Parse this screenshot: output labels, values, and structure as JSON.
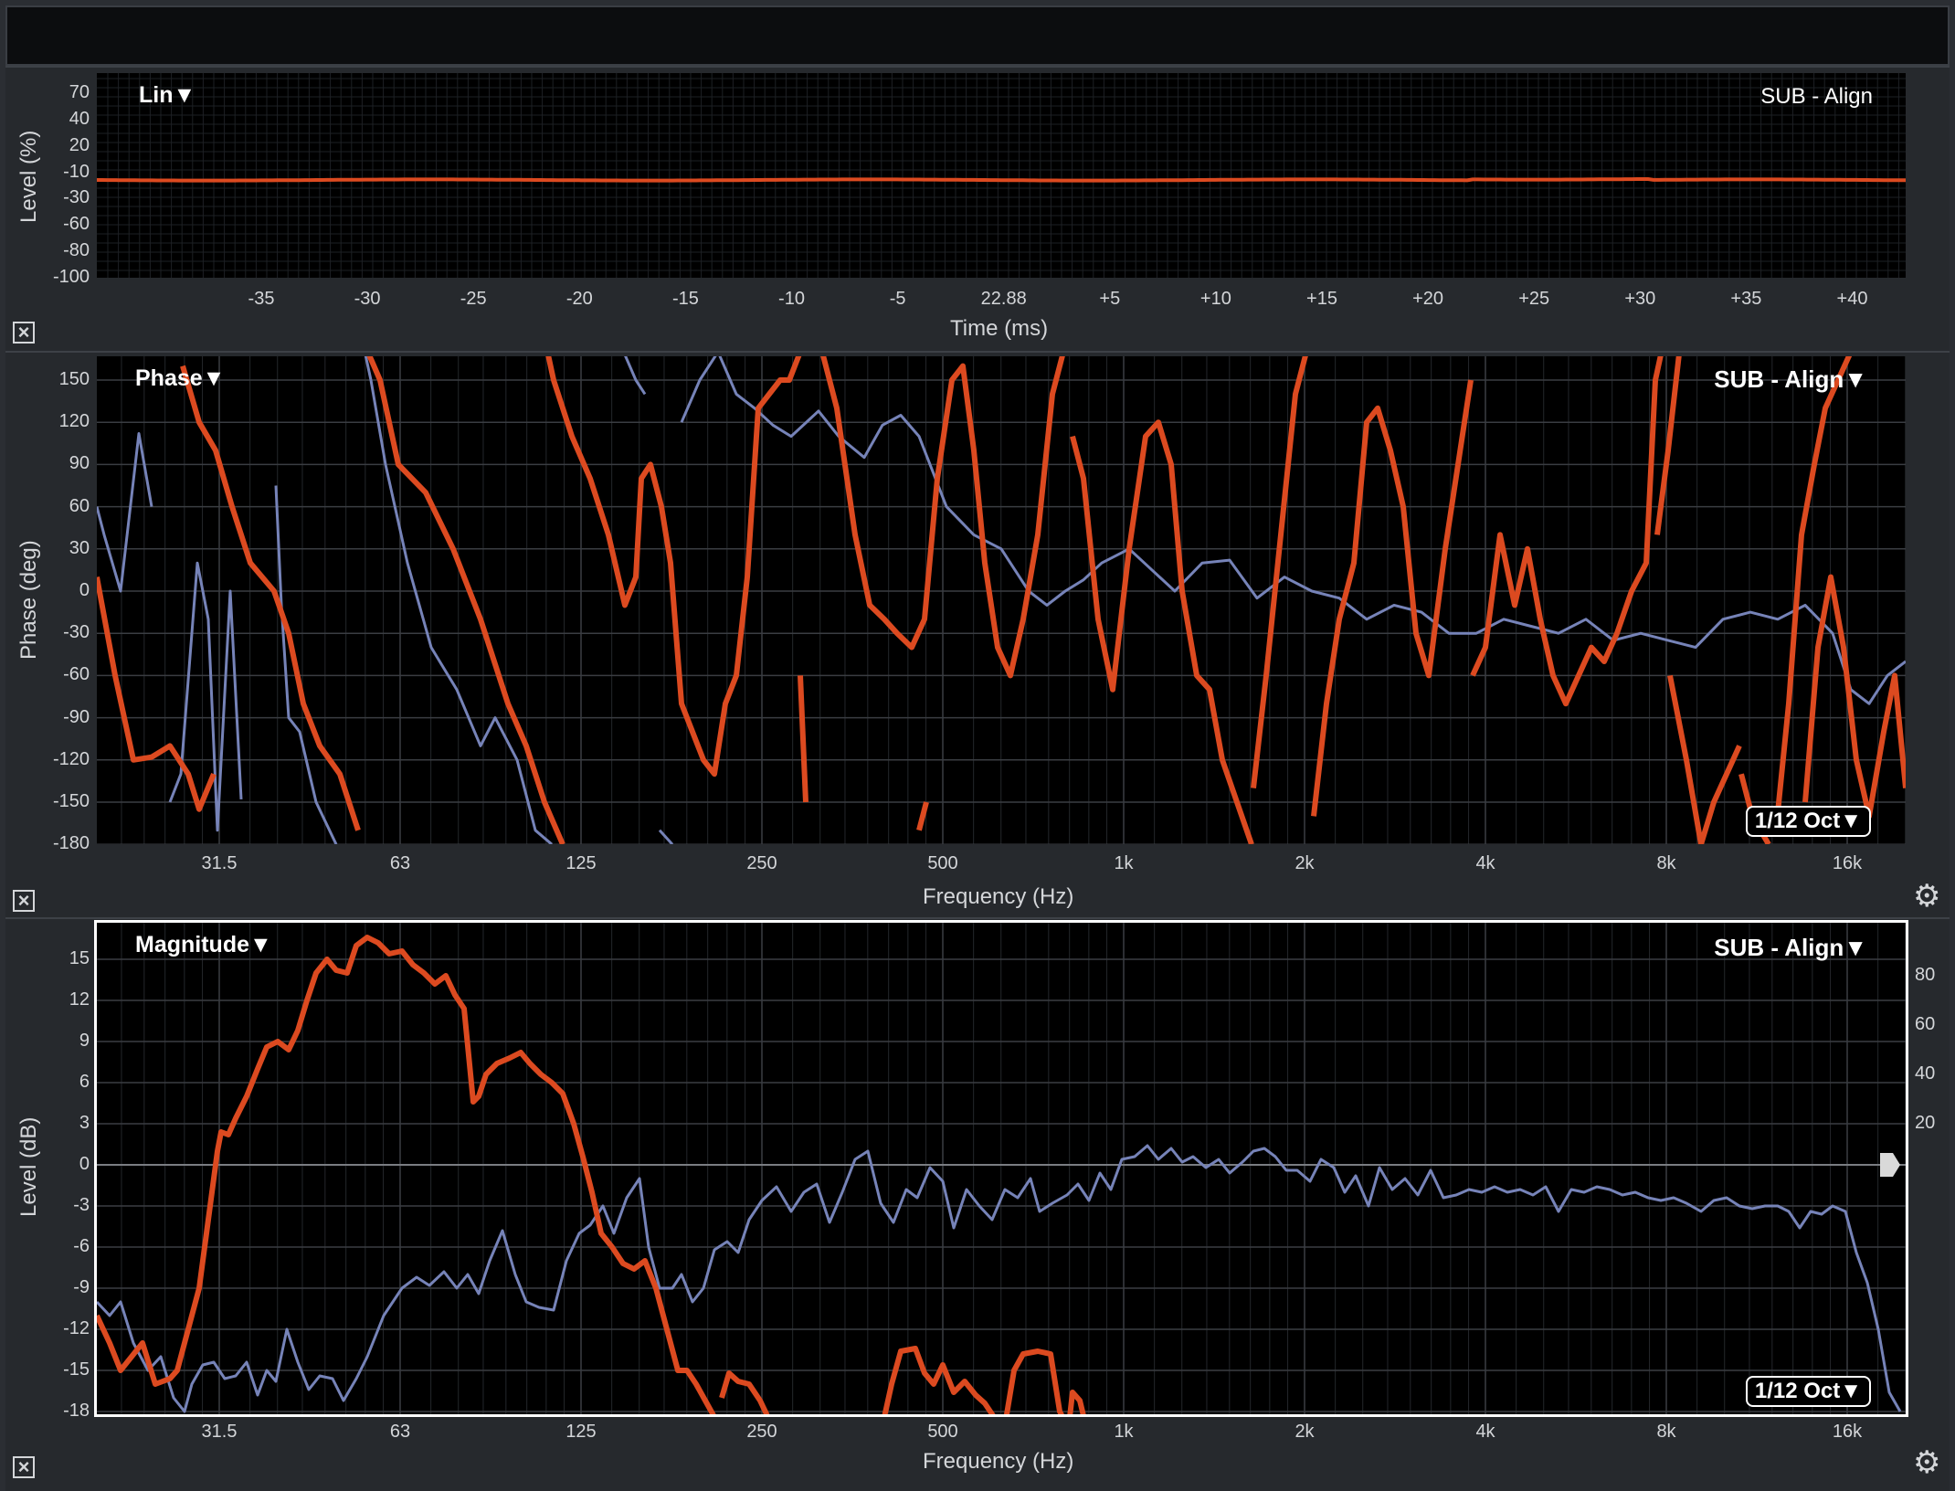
{
  "colors": {
    "trace_primary": "#dc4a20",
    "trace_secondary": "#7683b8",
    "grid": "#2c2f34",
    "background": "#000000"
  },
  "impulse": {
    "mode_label": "Lin▼",
    "measurement_label": "SUB - Align",
    "y_axis_label": "Level (%)",
    "y_ticks": [
      "70",
      "40",
      "20",
      "-10",
      "-30",
      "-60",
      "-80",
      "-100"
    ],
    "x_axis_label": "Time (ms)",
    "x_ticks": [
      "-35",
      "-30",
      "-25",
      "-20",
      "-15",
      "-10",
      "-5",
      "22.88",
      "+5",
      "+10",
      "+15",
      "+20",
      "+25",
      "+30",
      "+35",
      "+40"
    ],
    "close_icon": "close-box-icon"
  },
  "phase": {
    "mode_label": "Phase▼",
    "measurement_label": "SUB - Align▼",
    "y_axis_label": "Phase (deg)",
    "y_ticks": [
      "150",
      "120",
      "90",
      "60",
      "30",
      "0",
      "-30",
      "-60",
      "-90",
      "-120",
      "-150",
      "-180"
    ],
    "x_axis_label": "Frequency (Hz)",
    "x_ticks": [
      "31.5",
      "63",
      "125",
      "250",
      "500",
      "1k",
      "2k",
      "4k",
      "8k",
      "16k"
    ],
    "smoothing_label": "1/12 Oct▼",
    "close_icon": "close-box-icon",
    "settings_icon": "gear-icon"
  },
  "magnitude": {
    "mode_label": "Magnitude▼",
    "measurement_label": "SUB - Align▼",
    "y_axis_label": "Level (dB)",
    "y_ticks": [
      "15",
      "12",
      "9",
      "6",
      "3",
      "0",
      "-3",
      "-6",
      "-9",
      "-12",
      "-15",
      "-18"
    ],
    "y2_ticks": [
      "80",
      "60",
      "40",
      "20"
    ],
    "x_axis_label": "Frequency (Hz)",
    "x_ticks": [
      "31.5",
      "63",
      "125",
      "250",
      "500",
      "1k",
      "2k",
      "4k",
      "8k",
      "16k"
    ],
    "smoothing_label": "1/12 Oct▼",
    "close_icon": "close-box-icon",
    "settings_icon": "gear-icon",
    "reference_marker_icon": "arrow-marker-icon"
  }
}
